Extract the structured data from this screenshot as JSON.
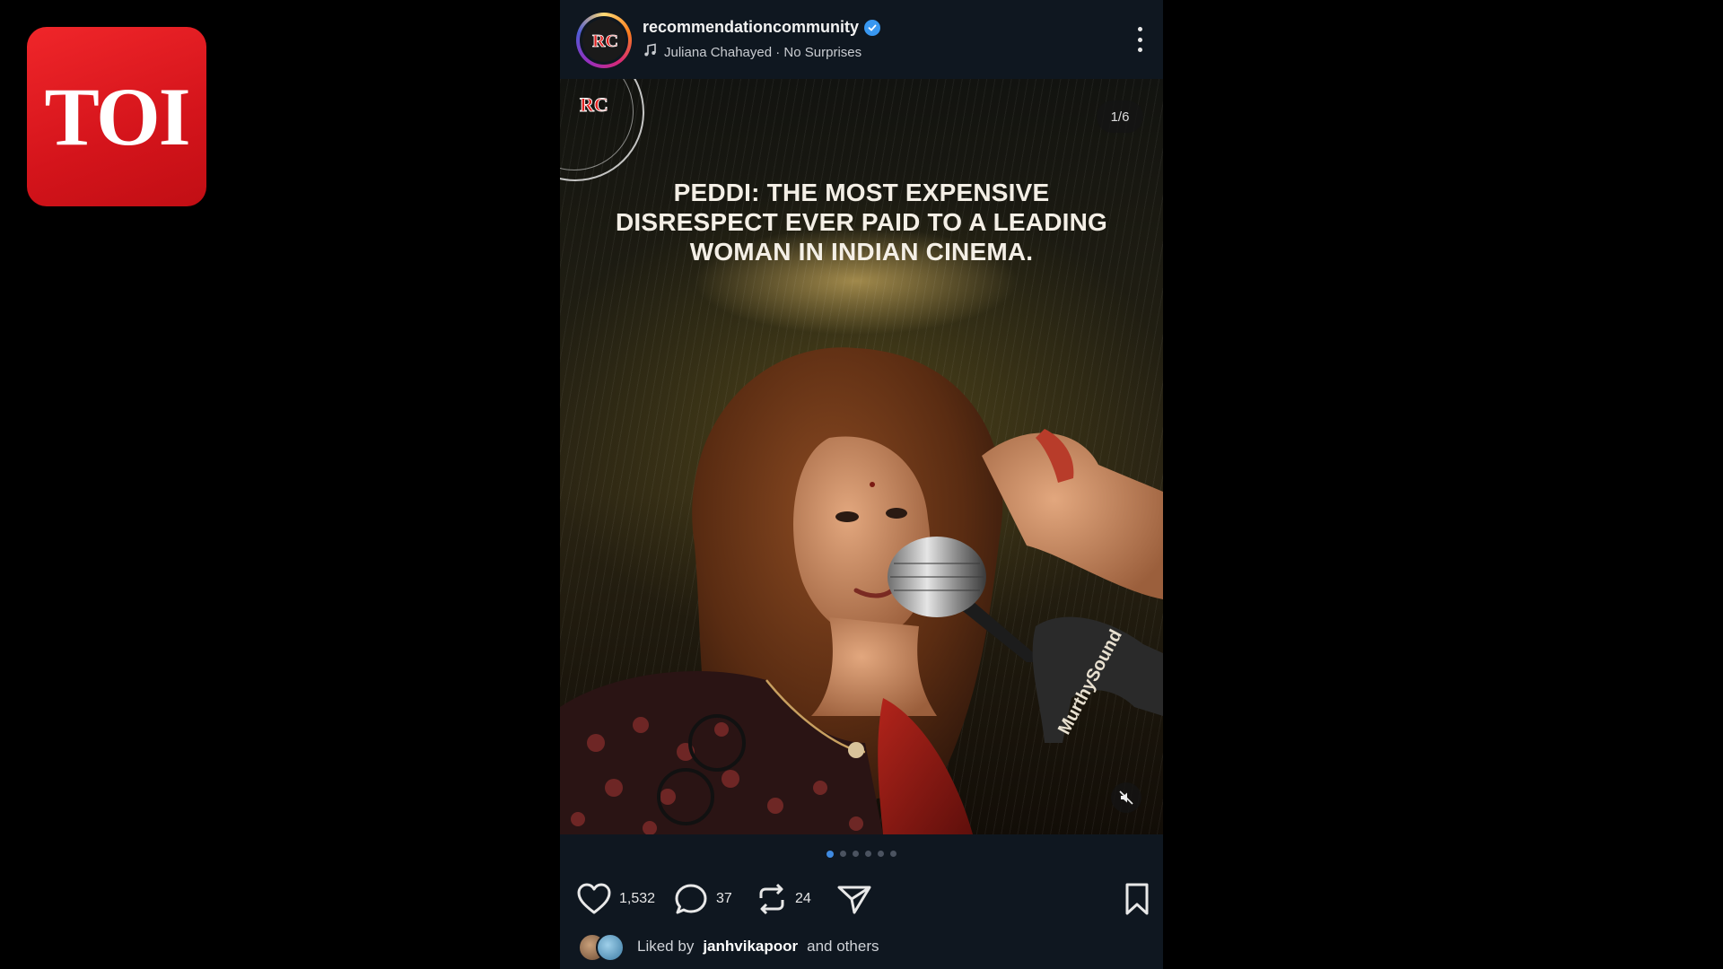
{
  "brand": {
    "logo_text": "TOI"
  },
  "post": {
    "username": "recommendationcommunity",
    "verified": true,
    "music": "Juliana Chahayed · No Surprises",
    "avatar_text": "RC",
    "media": {
      "counter": "1/6",
      "headline_lines": [
        "PEDDI: THE MOST EXPENSIVE",
        "DISRESPECT EVER PAID TO A LEADING",
        "WOMAN IN INDIAN CINEMA."
      ],
      "mic_brand": "MurthySound",
      "carousel_total": 6,
      "carousel_active": 1
    },
    "actions": {
      "likes": "1,532",
      "comments": "37",
      "reposts": "24"
    },
    "liked_by": {
      "prefix": "Liked by",
      "user": "janhvikapoor",
      "suffix": "and others"
    }
  },
  "colors": {
    "toi_red": "#e31e24",
    "verified_blue": "#3897f0",
    "dot_active": "#3f8ae0",
    "post_bg": "#0f1720"
  }
}
